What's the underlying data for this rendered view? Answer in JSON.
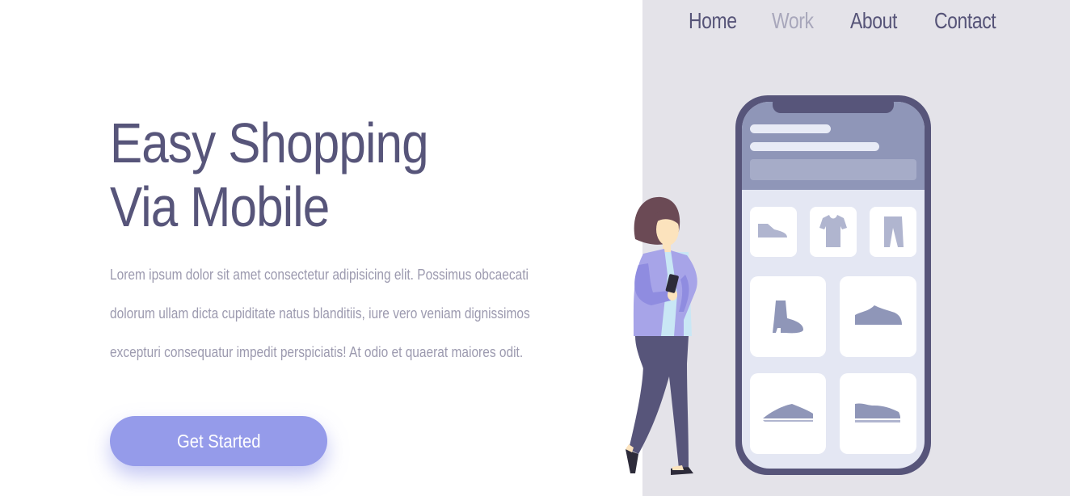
{
  "nav": {
    "items": [
      {
        "label": "Home",
        "active": false
      },
      {
        "label": "Work",
        "active": true
      },
      {
        "label": "About",
        "active": false
      },
      {
        "label": "Contact",
        "active": false
      }
    ]
  },
  "hero": {
    "title": "Easy Shopping Via Mobile",
    "description": "Lorem ipsum dolor sit amet consectetur adipisicing elit. Possimus obcaecati dolorum ullam dicta cupiditate natus blanditiis, iure vero veniam dignissimos excepturi consequatur impedit perspiciatis! At odio et quaerat maiores odit.",
    "cta_label": "Get Started"
  },
  "colors": {
    "accent": "#959bea",
    "text_dark": "#57557a",
    "text_muted": "#9c9aaf",
    "panel_bg": "#e4e3e9"
  },
  "illustration": {
    "icons": [
      "shoe-icon",
      "tshirt-icon",
      "pants-icon",
      "boot-icon",
      "sneaker-icon",
      "flat-shoe-icon",
      "loafer-icon"
    ]
  }
}
